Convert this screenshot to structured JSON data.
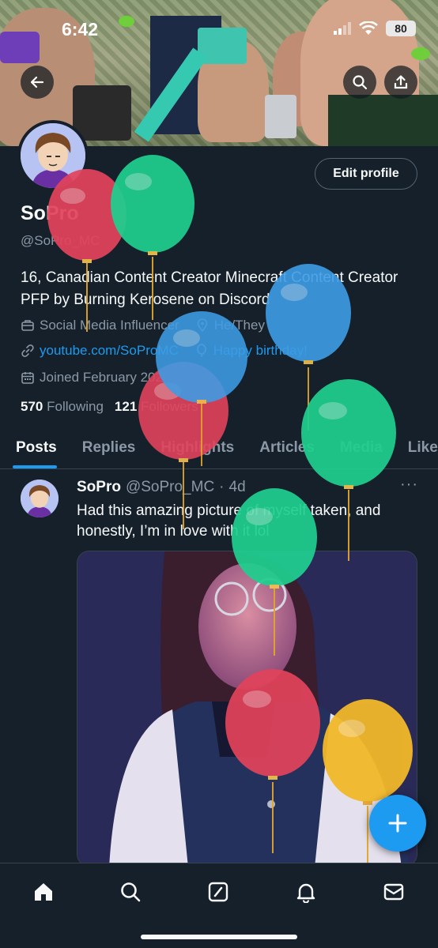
{
  "status_bar": {
    "time": "6:42",
    "battery": "80"
  },
  "profile": {
    "edit_button": "Edit profile",
    "name": "SoPro",
    "handle": "@SoPro_MC",
    "bio": "16, Canadian Content Creator Minecraft Content Creator PFP by Burning Kerosene on Discord",
    "category": "Social Media Influencer",
    "pronouns": "He/They",
    "website": "youtube.com/SoProMC",
    "birthday": "Happy birthday!",
    "joined": "Joined February 2020",
    "following_count": "570",
    "following_label": "Following",
    "followers_count": "121",
    "followers_label": "Followers"
  },
  "tabs": [
    "Posts",
    "Replies",
    "Highlights",
    "Articles",
    "Media",
    "Likes"
  ],
  "post": {
    "author": "SoPro",
    "handle": "@SoPro_MC",
    "separator": "·",
    "age": "4d",
    "more": "···",
    "text": "Had this amazing picture of myself taken, and honestly, I’m in love with it lol"
  },
  "colors": {
    "background": "#15202b",
    "accent": "#1d9bf0",
    "secondary_text": "#8b98a5",
    "balloon_red": "#e2435b",
    "balloon_green": "#1fcf8f",
    "balloon_blue": "#3d9de6",
    "balloon_yellow": "#f2b82a"
  },
  "icons": {
    "back": "back-arrow-icon",
    "search": "search-icon",
    "share": "share-icon",
    "compose": "plus-icon",
    "nav": [
      "home-icon",
      "search-icon",
      "grok-icon",
      "bell-icon",
      "mail-icon"
    ]
  }
}
